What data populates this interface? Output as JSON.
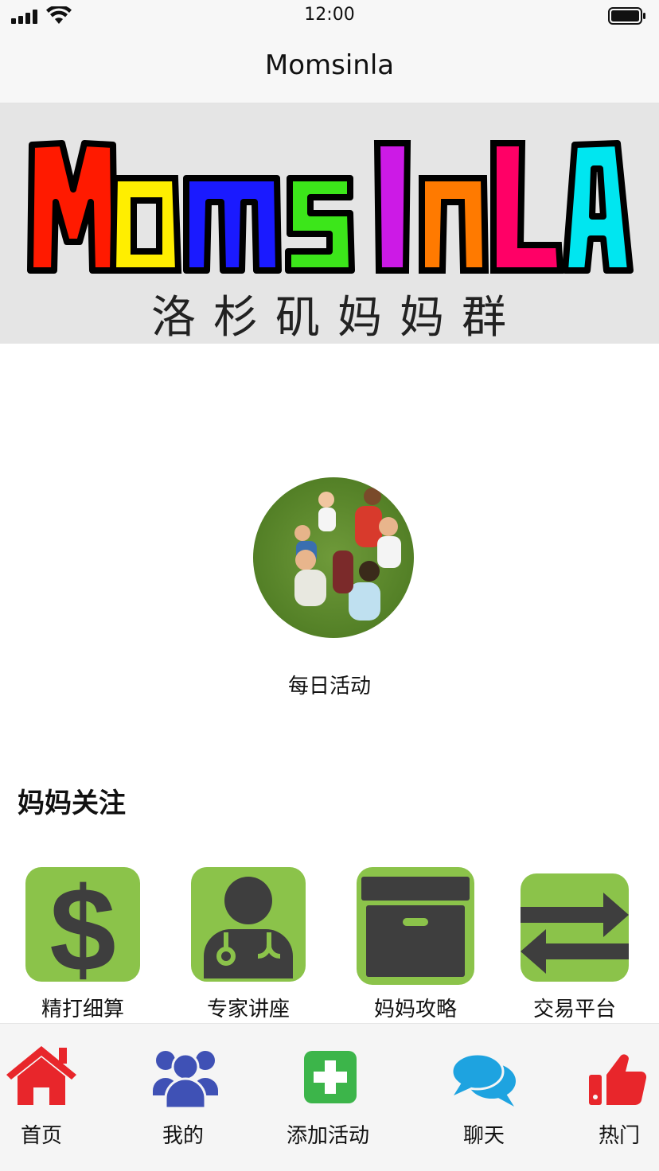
{
  "status": {
    "time": "12:00"
  },
  "nav": {
    "title": "Momsinla"
  },
  "banner": {
    "logo_letters": [
      "M",
      "o",
      "m",
      "s",
      "I",
      "n",
      "L",
      "A"
    ],
    "logo_colors": [
      "#ff1a00",
      "#ffee00",
      "#1a1aff",
      "#3ce61a",
      "#cc1ae6",
      "#ff7a00",
      "#ff0066",
      "#00e6f0"
    ],
    "subtitle": "洛杉矶妈妈群"
  },
  "activity": {
    "label": "每日活动"
  },
  "section": {
    "title": "妈妈关注"
  },
  "features": [
    {
      "label": "精打细算",
      "icon": "dollar-icon"
    },
    {
      "label": "专家讲座",
      "icon": "doctor-icon"
    },
    {
      "label": "妈妈攻略",
      "icon": "archive-box-icon"
    },
    {
      "label": "交易平台",
      "icon": "exchange-arrows-icon"
    }
  ],
  "tabs": [
    {
      "label": "首页",
      "icon": "home-icon",
      "color": "#e8262b"
    },
    {
      "label": "我的",
      "icon": "people-icon",
      "color": "#3f51b5"
    },
    {
      "label": "添加活动",
      "icon": "add-icon",
      "color": "#3cb54a"
    },
    {
      "label": "聊天",
      "icon": "chat-icon",
      "color": "#1ea3e0"
    },
    {
      "label": "热门",
      "icon": "thumbs-up-icon",
      "color": "#e8262b"
    }
  ],
  "colors": {
    "tile_green": "#8bc34a",
    "icon_dark": "#3e3e3e"
  }
}
